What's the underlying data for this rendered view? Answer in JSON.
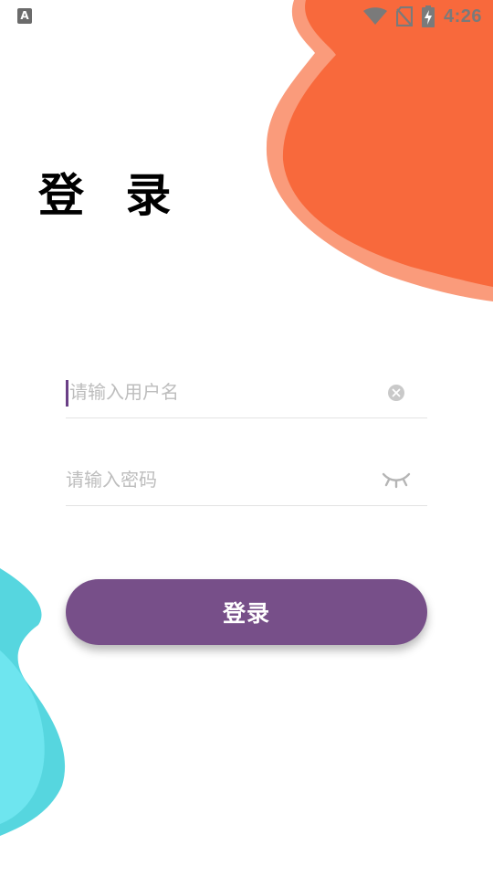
{
  "status_bar": {
    "app_icon_letter": "A",
    "wifi_icon": "wifi-icon",
    "sim_icon": "no-sim-icon",
    "battery_icon": "battery-charging-icon",
    "time": "4:26"
  },
  "title": "登 录",
  "form": {
    "username": {
      "value": "",
      "placeholder": "请输入用户名",
      "clear_icon": "clear-icon"
    },
    "password": {
      "value": "",
      "placeholder": "请输入密码",
      "visibility_icon": "eye-closed-icon"
    },
    "login_label": "登录"
  },
  "colors": {
    "accent": "#774f89",
    "cursor": "#6a3f86",
    "orange_blob": "#f8693c",
    "orange_blob_light": "#fa9b7b",
    "cyan_blob": "#6ee5ef",
    "cyan_blob_dark": "#56d6df",
    "placeholder": "#bdbdbd",
    "divider": "#e3e3e3"
  }
}
